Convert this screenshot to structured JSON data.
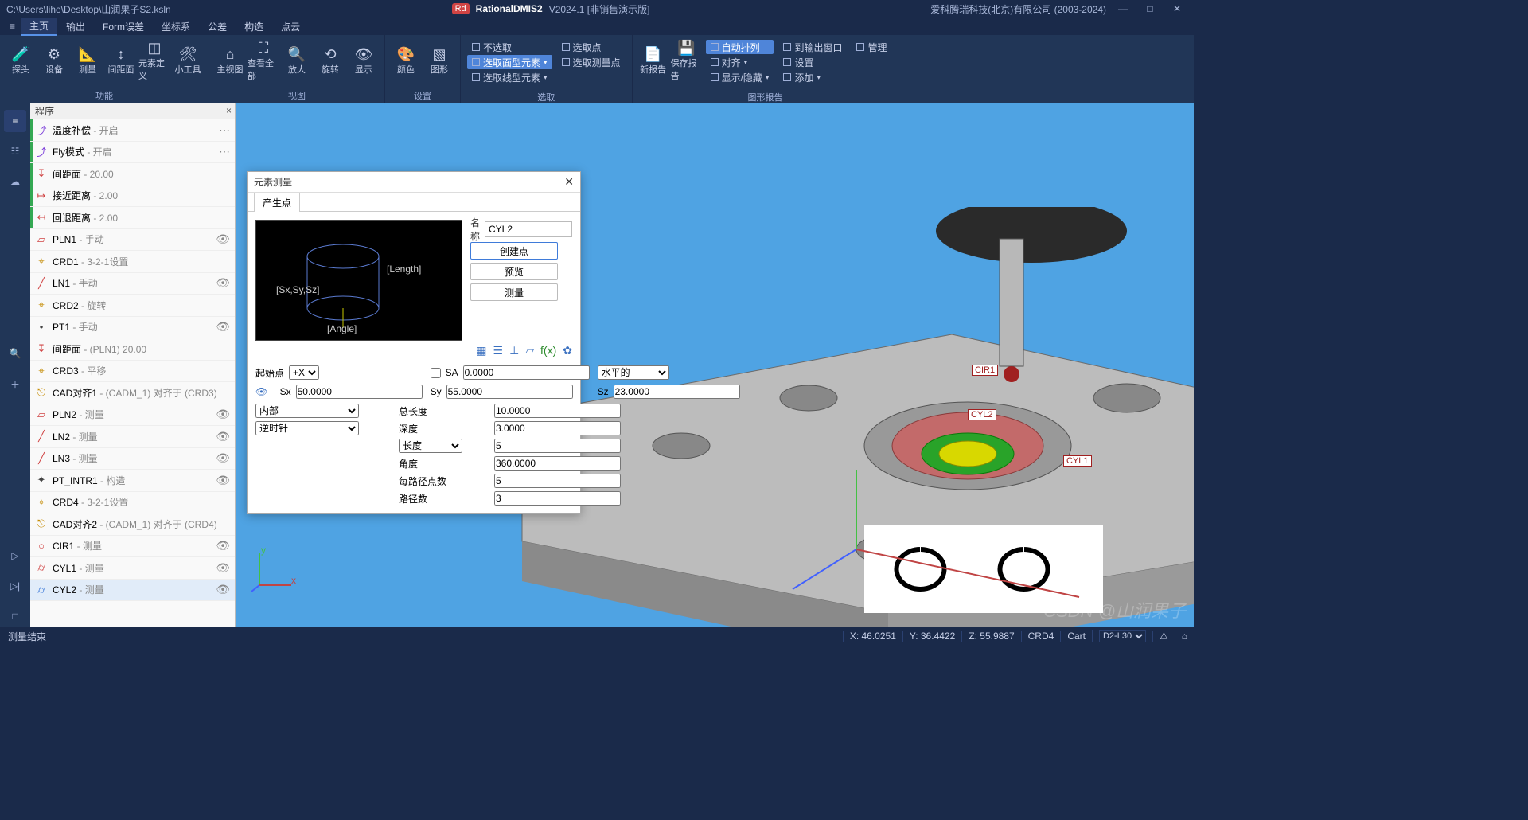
{
  "title": {
    "path": "C:\\Users\\lihe\\Desktop\\山润果子S2.ksln",
    "brand": "RationalDMIS2",
    "version": "V2024.1 [非销售演示版]",
    "company": "爱科腾瑞科技(北京)有限公司 (2003-2024)"
  },
  "menu": {
    "items": [
      "主页",
      "输出",
      "Form误差",
      "坐标系",
      "公差",
      "构造",
      "点云"
    ],
    "active": 0
  },
  "ribbon": {
    "g1": {
      "label": "功能",
      "items": [
        "探头",
        "设备",
        "测量",
        "间距面",
        "元素定义",
        "小工具"
      ]
    },
    "g2": {
      "label": "视图",
      "items": [
        "主视图",
        "查看全部",
        "放大",
        "旋转",
        "显示"
      ]
    },
    "g3": {
      "label": "设置",
      "items": [
        "颜色",
        "图形"
      ]
    },
    "g4": {
      "label": "选取",
      "col1": [
        {
          "t": "不选取",
          "s": false
        },
        {
          "t": "选取面型元素",
          "s": true
        },
        {
          "t": "选取线型元素",
          "s": false
        }
      ],
      "col2": [
        {
          "t": "选取点",
          "s": false
        },
        {
          "t": "选取测量点",
          "s": false
        }
      ]
    },
    "g5": {
      "label": "图形报告",
      "items": [
        "新报告",
        "保存报告"
      ],
      "col1": [
        {
          "t": "自动排列",
          "s": true
        },
        {
          "t": "对齐",
          "s": false
        },
        {
          "t": "显示/隐藏",
          "s": false
        }
      ],
      "col2": [
        {
          "t": "到输出窗口",
          "s": false
        },
        {
          "t": "设置",
          "s": false
        },
        {
          "t": "添加",
          "s": false
        }
      ],
      "col3": [
        {
          "t": "管理",
          "s": false
        }
      ]
    }
  },
  "program": {
    "header": "程序",
    "rows": [
      {
        "icon": "⤴",
        "c": "#7a3bd9",
        "name": "温度补偿",
        "sub": " - 开启",
        "dots": true,
        "bar": "#34a853"
      },
      {
        "icon": "⤴",
        "c": "#7a3bd9",
        "name": "Fly模式",
        "sub": " - 开启",
        "dots": true,
        "bar": "#34a853"
      },
      {
        "icon": "↧",
        "c": "#d04444",
        "name": "间距面",
        "sub": " - 20.00",
        "bar": "#34a853"
      },
      {
        "icon": "↦",
        "c": "#d04444",
        "name": "接近距离",
        "sub": " - 2.00",
        "bar": "#34a853"
      },
      {
        "icon": "↤",
        "c": "#d04444",
        "name": "回退距离",
        "sub": " - 2.00",
        "bar": "#34a853"
      },
      {
        "icon": "▱",
        "c": "#d04444",
        "name": "PLN1",
        "sub": " - 手动",
        "eye": true
      },
      {
        "icon": "⌖",
        "c": "#c48a00",
        "name": "CRD1",
        "sub": " - 3-2-1设置"
      },
      {
        "icon": "╱",
        "c": "#d04444",
        "name": "LN1",
        "sub": " - 手动",
        "eye": true
      },
      {
        "icon": "⌖",
        "c": "#c48a00",
        "name": "CRD2",
        "sub": " - 旋转"
      },
      {
        "icon": "•",
        "c": "#444",
        "name": "PT1",
        "sub": " - 手动",
        "eye": true
      },
      {
        "icon": "↧",
        "c": "#d04444",
        "name": "间距面",
        "sub": " - (PLN1) 20.00"
      },
      {
        "icon": "⌖",
        "c": "#c48a00",
        "name": "CRD3",
        "sub": " - 平移"
      },
      {
        "icon": "⎋",
        "c": "#c48a00",
        "name": "CAD对齐1",
        "sub": " - (CADM_1) 对齐于 (CRD3)"
      },
      {
        "icon": "▱",
        "c": "#d04444",
        "name": "PLN2",
        "sub": " - 测量",
        "eye": true
      },
      {
        "icon": "╱",
        "c": "#d04444",
        "name": "LN2",
        "sub": " - 测量",
        "eye": true
      },
      {
        "icon": "╱",
        "c": "#d04444",
        "name": "LN3",
        "sub": " - 测量",
        "eye": true
      },
      {
        "icon": "✦",
        "c": "#444",
        "name": "PT_INTR1",
        "sub": " - 构造",
        "eye": true
      },
      {
        "icon": "⌖",
        "c": "#c48a00",
        "name": "CRD4",
        "sub": " - 3-2-1设置"
      },
      {
        "icon": "⎋",
        "c": "#c48a00",
        "name": "CAD对齐2",
        "sub": " - (CADM_1) 对齐于 (CRD4)"
      },
      {
        "icon": "○",
        "c": "#d04444",
        "name": "CIR1",
        "sub": " - 测量",
        "eye": true
      },
      {
        "icon": "⌭",
        "c": "#d04444",
        "name": "CYL1",
        "sub": " - 测量",
        "eye": true
      },
      {
        "icon": "⌭",
        "c": "#3f7bd9",
        "name": "CYL2",
        "sub": " - 测量",
        "eye": true,
        "selected": true
      }
    ]
  },
  "dialog": {
    "title": "元素测量",
    "tab": "产生点",
    "name_lbl": "名称",
    "name_val": "CYL2",
    "btn_create": "创建点",
    "btn_preview": "预览",
    "btn_measure": "测量",
    "preview_labels": {
      "length": "[Length]",
      "sxyz": "[Sx,Sy,Sz]",
      "angle": "[Angle]"
    },
    "start_lbl": "起始点",
    "start_dir": "+X",
    "sa_lbl": "SA",
    "sa_val": "0.0000",
    "orient": "水平的",
    "sx_lbl": "Sx",
    "sx_val": "50.0000",
    "sy_lbl": "Sy",
    "sy_val": "55.0000",
    "sz_lbl": "Sz",
    "sz_val": "23.0000",
    "side": "内部",
    "rot": "逆时针",
    "total_len_lbl": "总长度",
    "total_len": "10.0000",
    "depth_lbl": "深度",
    "depth": "3.0000",
    "len_mode": "长度",
    "len_val": "5",
    "angle_lbl": "角度",
    "angle": "360.0000",
    "ppp_lbl": "每路径点数",
    "ppp": "5",
    "paths_lbl": "路径数",
    "paths": "3"
  },
  "tags3d": {
    "cir1": "CIR1",
    "cyl1": "CYL1",
    "cyl2": "CYL2"
  },
  "status": {
    "left": "测量结束",
    "x": "X: 46.0251",
    "y": "Y: 36.4422",
    "z": "Z: 55.9887",
    "crd": "CRD4",
    "cart": "Cart",
    "probe": "D2-L30"
  },
  "watermark": "CSDN @山润果子"
}
